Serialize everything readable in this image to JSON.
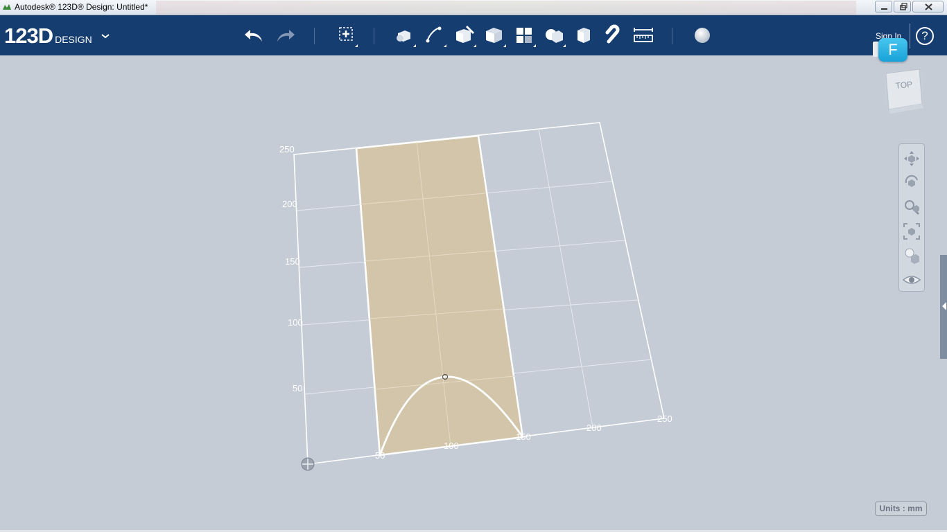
{
  "window": {
    "title": "Autodesk® 123D® Design: Untitled*"
  },
  "toolbar": {
    "logo_main": "123D",
    "logo_sub": "DESIGN",
    "sign_in": "Sign In",
    "help": "?",
    "icons": [
      "undo-icon",
      "redo-icon",
      "transform-icon",
      "primitives-icon",
      "sketch-icon",
      "construct-icon",
      "modify-icon",
      "pattern-icon",
      "grouping-icon",
      "combine-icon",
      "snap-icon",
      "measure-icon",
      "material-icon"
    ]
  },
  "f_badge": "F",
  "view_cube": {
    "face": "TOP"
  },
  "grid": {
    "y_labels": [
      "250",
      "200",
      "150",
      "100",
      "50"
    ],
    "x_labels": [
      "50",
      "100",
      "150",
      "200",
      "250"
    ]
  },
  "units": "Units : mm",
  "colors": {
    "toolbar_bg": "#153d70",
    "canvas_bg": "#c5ccd6",
    "sketch_fill": "#d2c5a9",
    "grid_line": "#ffffff",
    "f_badge": "#2cb3e4"
  }
}
